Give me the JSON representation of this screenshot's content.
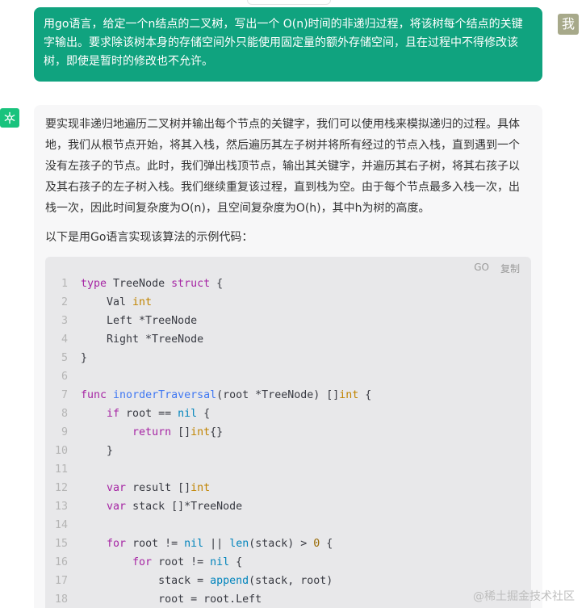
{
  "user": {
    "avatar_text": "我",
    "message": "用go语言，给定一个n结点的二叉树，写出一个 O(n)时间的非递归过程，将该树每个结点的关键字输出。要求除该树本身的存储空间外只能使用固定量的额外存储空间，且在过程中不得修改该树，即使是暂时的修改也不允许。"
  },
  "assistant": {
    "paragraph1": "要实现非递归地遍历二叉树并输出每个节点的关键字，我们可以使用栈来模拟递归的过程。具体地，我们从根节点开始，将其入栈，然后遍历其左子树并将所有经过的节点入栈，直到遇到一个没有左孩子的节点。此时，我们弹出栈顶节点，输出其关键字，并遍历其右子树，将其右孩子以及其右孩子的左子树入栈。我们继续重复该过程，直到栈为空。由于每个节点最多入栈一次，出栈一次，因此时间复杂度为O(n)，且空间复杂度为O(h)，其中h为树的高度。",
    "paragraph2": "以下是用Go语言实现该算法的示例代码："
  },
  "code": {
    "language": "GO",
    "copy_label": "复制",
    "lines": [
      {
        "n": "1",
        "html": "<span class=\"kw\">type</span> TreeNode <span class=\"kw\">struct</span> {"
      },
      {
        "n": "2",
        "html": "    Val <span class=\"ty\">int</span>"
      },
      {
        "n": "3",
        "html": "    Left *TreeNode"
      },
      {
        "n": "4",
        "html": "    Right *TreeNode"
      },
      {
        "n": "5",
        "html": "}"
      },
      {
        "n": "6",
        "html": ""
      },
      {
        "n": "7",
        "html": "<span class=\"kw\">func</span> <span class=\"fn\">inorderTraversal</span>(root *TreeNode) []<span class=\"ty\">int</span> {"
      },
      {
        "n": "8",
        "html": "    <span class=\"kw\">if</span> root == <span class=\"bi\">nil</span> {"
      },
      {
        "n": "9",
        "html": "        <span class=\"kw\">return</span> []<span class=\"ty\">int</span>{}"
      },
      {
        "n": "10",
        "html": "    }"
      },
      {
        "n": "11",
        "html": ""
      },
      {
        "n": "12",
        "html": "    <span class=\"kw\">var</span> result []<span class=\"ty\">int</span>"
      },
      {
        "n": "13",
        "html": "    <span class=\"kw\">var</span> stack []*TreeNode"
      },
      {
        "n": "14",
        "html": ""
      },
      {
        "n": "15",
        "html": "    <span class=\"kw\">for</span> root != <span class=\"bi\">nil</span> || <span class=\"bi\">len</span>(stack) &gt; <span class=\"nm\">0</span> {"
      },
      {
        "n": "16",
        "html": "        <span class=\"kw\">for</span> root != <span class=\"bi\">nil</span> {"
      },
      {
        "n": "17",
        "html": "            stack = <span class=\"bi\">append</span>(stack, root)"
      },
      {
        "n": "18",
        "html": "            root = root.Left"
      }
    ]
  },
  "watermark": "@稀土掘金技术社区",
  "colors": {
    "user_bubble": "#10a37f",
    "assistant_panel": "#f7f7f8",
    "code_background": "#e8e8ea"
  },
  "icons": {
    "assistant_avatar": "openai-logo-icon"
  }
}
